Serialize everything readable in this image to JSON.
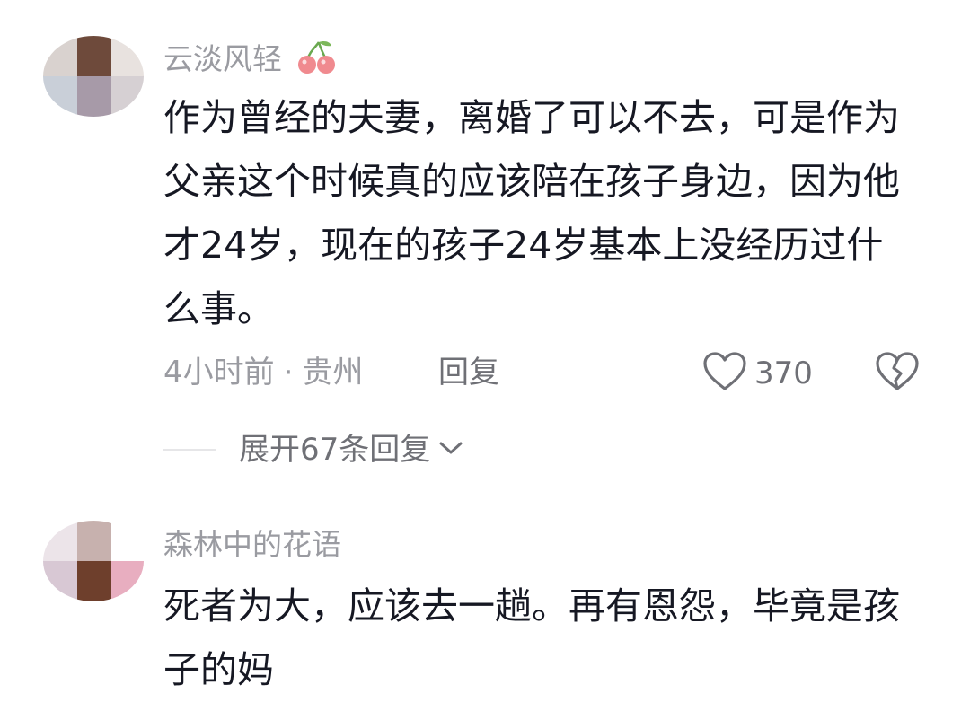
{
  "comments": [
    {
      "username": "云淡风轻",
      "username_emoji": "cherry-icon",
      "text": "作为曾经的夫妻，离婚了可以不去，可是作为父亲这个时候真的应该陪在孩子身边，因为他才24岁，现在的孩子24岁基本上没经历过什么事。",
      "time": "4小时前",
      "separator": "·",
      "location": "贵州",
      "reply_label": "回复",
      "like_count": "370",
      "expand_label": "展开67条回复"
    },
    {
      "username": "森林中的花语",
      "text": "死者为大，应该去一趟。再有恩怨，毕竟是孩子的妈"
    }
  ],
  "colors": {
    "username": "#9a9ba1",
    "body": "#161823",
    "meta": "#9a9ba1",
    "action": "#6f7076",
    "divider": "#e6e6e8"
  }
}
